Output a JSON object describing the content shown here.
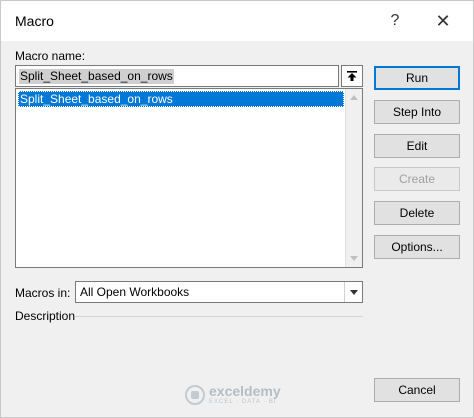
{
  "window": {
    "title": "Macro",
    "help_glyph": "?",
    "close_glyph": "✕"
  },
  "macro_name": {
    "label": "Macro name:",
    "value": "Split_Sheet_based_on_rows"
  },
  "macro_list": {
    "items": [
      "Split_Sheet_based_on_rows"
    ],
    "selected_index": 0
  },
  "macros_in": {
    "label": "Macros in:",
    "selected": "All Open Workbooks"
  },
  "description": {
    "label": "Description"
  },
  "buttons": {
    "run": "Run",
    "step_into": "Step Into",
    "edit": "Edit",
    "create": "Create",
    "delete": "Delete",
    "options": "Options...",
    "cancel": "Cancel"
  },
  "watermark": {
    "name": "exceldemy",
    "tagline": "EXCEL · DATA · BI"
  },
  "colors": {
    "selection": "#0078d7",
    "dialog_bg": "#f0f0f0"
  },
  "icons": {
    "upload": "upload-arrow-icon",
    "scroll_up": "scroll-up-arrow-icon",
    "scroll_down": "scroll-down-arrow-icon",
    "dropdown": "chevron-down-icon"
  }
}
